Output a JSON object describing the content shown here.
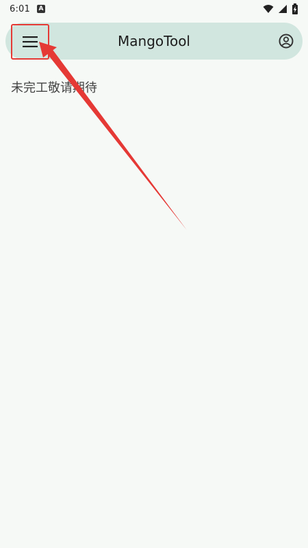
{
  "status_bar": {
    "time": "6:01",
    "notification_icon": "a-letter-icon",
    "wifi_icon": "wifi-icon",
    "signal_icon": "signal-icon",
    "battery_icon": "battery-charging-icon"
  },
  "app_bar": {
    "title": "MangoTool",
    "menu_icon": "hamburger-menu-icon",
    "account_icon": "account-circle-icon",
    "color": "#d1e6df"
  },
  "main": {
    "message": "未完工敬请期待"
  },
  "annotation": {
    "highlight_color": "#e53935"
  }
}
